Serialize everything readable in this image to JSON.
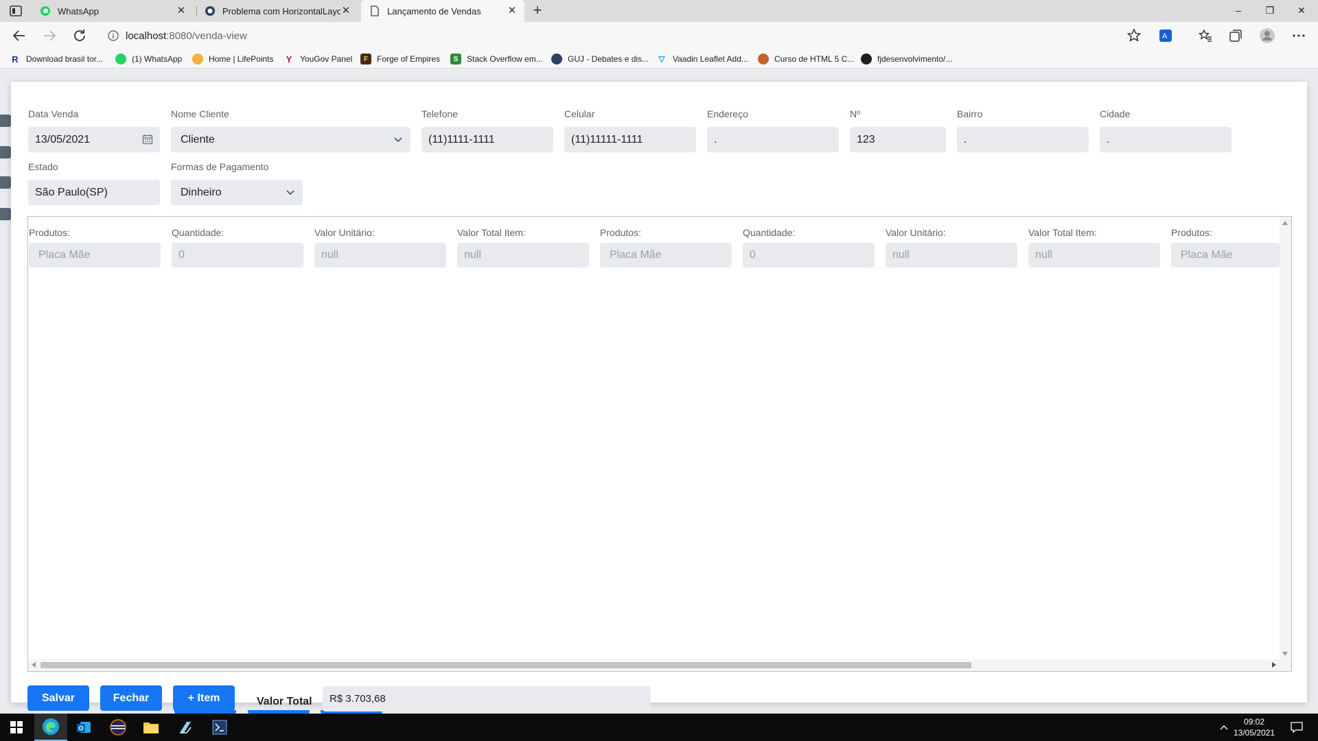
{
  "browser": {
    "tabs": [
      {
        "title": "WhatsApp",
        "active": false
      },
      {
        "title": "Problema com HorizontalLayout",
        "active": false
      },
      {
        "title": "Lançamento de Vendas",
        "active": true
      }
    ],
    "url_host": "localhost",
    "url_path": ":8080/venda-view",
    "bookmarks": [
      "Download brasil tor...",
      "(1) WhatsApp",
      "Home | LifePoints",
      "YouGov Panel",
      "Forge of Empires",
      "Stack Overflow em...",
      "GUJ - Debates e dis...",
      "Vaadin Leaflet Add...",
      "Curso de HTML 5 C...",
      "fjdesenvolvimento/..."
    ]
  },
  "form": {
    "data_venda": {
      "label": "Data Venda",
      "value": "13/05/2021"
    },
    "nome_cliente": {
      "label": "Nome Cliente",
      "value": "Cliente"
    },
    "telefone": {
      "label": "Telefone",
      "value": "(11)1111-1111"
    },
    "celular": {
      "label": "Celular",
      "value": "(11)11111-1111"
    },
    "endereco": {
      "label": "Endereço",
      "value": "."
    },
    "numero": {
      "label": "Nº",
      "value": "123"
    },
    "bairro": {
      "label": "Bairro",
      "value": "."
    },
    "cidade": {
      "label": "Cidade",
      "value": "."
    },
    "estado": {
      "label": "Estado",
      "value": "São Paulo(SP)"
    },
    "pagamento": {
      "label": "Formas de Pagamento",
      "value": "Dinheiro"
    }
  },
  "items": [
    {
      "label": "Produtos:",
      "value": "Placa Mãe",
      "kind": "prod"
    },
    {
      "label": "Quantidade:",
      "value": "0",
      "kind": "num"
    },
    {
      "label": "Valor Unitário:",
      "value": "null",
      "kind": "num"
    },
    {
      "label": "Valor Total Item:",
      "value": "null",
      "kind": "num"
    },
    {
      "label": "Produtos:",
      "value": "Placa Mãe",
      "kind": "prod"
    },
    {
      "label": "Quantidade:",
      "value": "0",
      "kind": "num"
    },
    {
      "label": "Valor Unitário:",
      "value": "null",
      "kind": "num"
    },
    {
      "label": "Valor Total Item:",
      "value": "null",
      "kind": "num"
    },
    {
      "label": "Produtos:",
      "value": "Placa Mãe",
      "kind": "prod"
    }
  ],
  "footer": {
    "salvar": "Salvar",
    "fechar": "Fechar",
    "item": "+ Item",
    "valor_total_label": "Valor Total",
    "valor_total": "R$ 3.703,68"
  },
  "taskbar": {
    "time": "09:02",
    "date": "13/05/2021"
  },
  "colors": {
    "accent": "#1676f3",
    "field_bg": "#e8eaed"
  }
}
